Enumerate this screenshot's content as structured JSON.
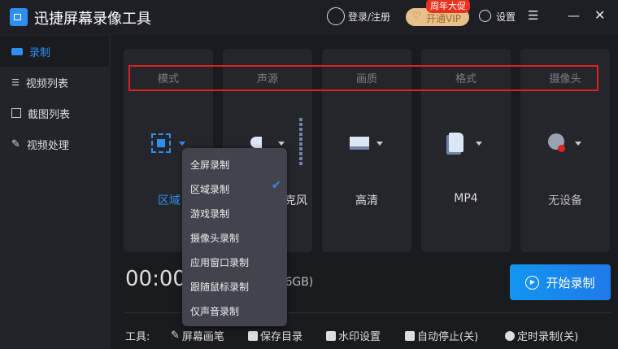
{
  "app": {
    "title": "迅捷屏幕录像工具",
    "login": "登录/注册",
    "vip": "开通VIP",
    "promo": "周年大促",
    "settings": "设置"
  },
  "sidebar": {
    "items": [
      {
        "label": "录制"
      },
      {
        "label": "视频列表"
      },
      {
        "label": "截图列表"
      },
      {
        "label": "视频处理"
      }
    ]
  },
  "cards": [
    {
      "label": "模式",
      "value": "区域"
    },
    {
      "label": "声源",
      "value": "麦克风"
    },
    {
      "label": "画质",
      "value": "高清"
    },
    {
      "label": "格式",
      "value": "MP4"
    },
    {
      "label": "摄像头",
      "value": "无设备"
    }
  ],
  "dropdown": {
    "items": [
      "全屏录制",
      "区域录制",
      "游戏录制",
      "摄像头录制",
      "应用窗口录制",
      "跟随鼠标录制",
      "仅声音录制"
    ],
    "selected": "区域录制"
  },
  "timer": "00:00",
  "storage": ".6GB)",
  "start_button": "开始录制",
  "tools": {
    "label": "工具:",
    "items": [
      "屏幕画笔",
      "保存目录",
      "水印设置",
      "自动停止(关)",
      "定时录制(关)"
    ]
  },
  "colors": {
    "accent": "#2f8ff0",
    "start": "#1e88e5",
    "highlight": "#e02020"
  }
}
